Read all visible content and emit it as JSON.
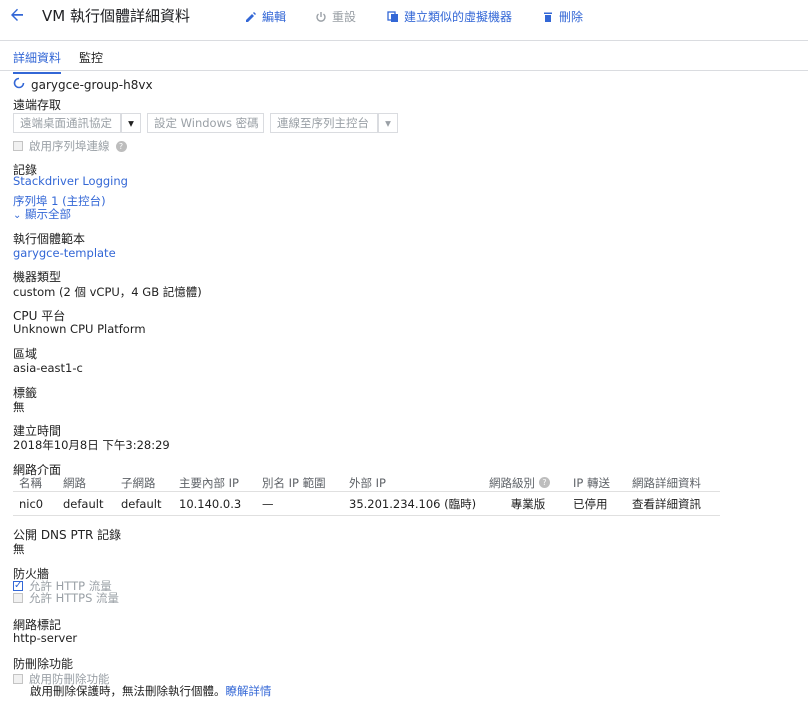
{
  "header": {
    "title": "VM 執行個體詳細資料",
    "edit": "編輯",
    "reset": "重設",
    "create_similar": "建立類似的虛擬機器",
    "delete": "刪除"
  },
  "tabs": [
    "詳細資料",
    "監控"
  ],
  "instance_name": "garygce-group-h8vx",
  "remote_access": {
    "label": "遠端存取",
    "rdp_button": "遠端桌面通訊協定",
    "windows_password_button": "設定 Windows 密碼",
    "serial_console_button": "連線至序列主控台",
    "serial_port_label": "啟用序列埠連線"
  },
  "logs": {
    "label": "記錄",
    "stackdriver": "Stackdriver Logging",
    "serial_port": "序列埠 1 (主控台)",
    "show_all": "顯示全部"
  },
  "template": {
    "label": "執行個體範本",
    "value": "garygce-template"
  },
  "machine_type": {
    "label": "機器類型",
    "value": "custom (2 個 vCPU，4 GB 記憶體)"
  },
  "cpu_platform": {
    "label": "CPU 平台",
    "value": "Unknown CPU Platform"
  },
  "zone": {
    "label": "區域",
    "value": "asia-east1-c"
  },
  "labels": {
    "label": "標籤",
    "value": "無"
  },
  "creation_time": {
    "label": "建立時間",
    "value": "2018年10月8日 下午3:28:29"
  },
  "network_interfaces": {
    "label": "網路介面",
    "columns": [
      "名稱",
      "網路",
      "子網路",
      "主要內部 IP",
      "別名 IP 範圍",
      "外部 IP",
      "網路級別",
      "IP 轉送",
      "網路詳細資料"
    ],
    "rows": [
      [
        "nic0",
        "default",
        "default",
        "10.140.0.3",
        "—",
        "35.201.234.106 (臨時)",
        "專業版",
        "已停用",
        "查看詳細資訊"
      ]
    ]
  },
  "dns_ptr": {
    "label": "公開 DNS PTR 記錄",
    "value": "無"
  },
  "firewall": {
    "label": "防火牆",
    "http": "允許 HTTP 流量",
    "https": "允許 HTTPS 流量",
    "http_checked": true,
    "https_checked": false
  },
  "network_tags": {
    "label": "網路標記",
    "value": "http-server"
  },
  "deletion_protection": {
    "label": "防刪除功能",
    "checkbox": "啟用防刪除功能",
    "description": "啟用刪除保護時，無法刪除執行個體。",
    "learn_more": "瞭解詳情"
  },
  "colors": {
    "accent": "#3367d6",
    "disabled": "#9aa0a6"
  }
}
